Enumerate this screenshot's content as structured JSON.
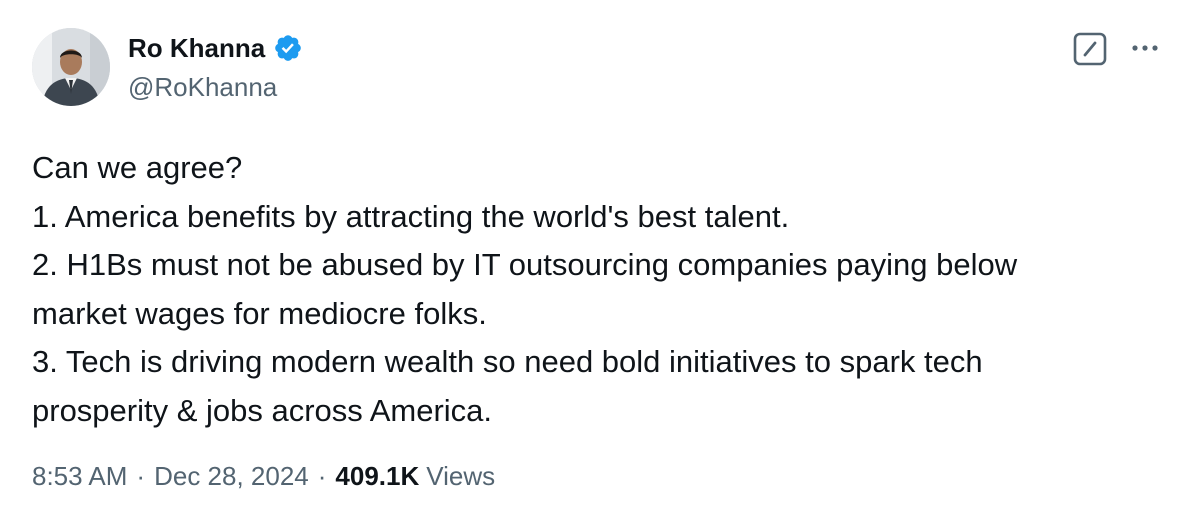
{
  "author": {
    "display_name": "Ro Khanna",
    "handle": "@RoKhanna",
    "verified": true,
    "verified_color": "#1d9bf0"
  },
  "icons": {
    "verified": "verified-badge-icon",
    "grok": "grok-icon",
    "more": "more-dots-icon"
  },
  "tweet": {
    "lines": [
      "Can we agree?",
      "1. America benefits by attracting the world's best talent.",
      "2. H1Bs must not be abused by IT outsourcing companies paying below",
      "market wages for mediocre folks.",
      "3. Tech is driving modern wealth so need bold initiatives to spark tech",
      "prosperity & jobs across America."
    ]
  },
  "meta": {
    "time": "8:53 AM",
    "separator": "·",
    "date": "Dec 28, 2024",
    "views_count": "409.1K",
    "views_label": "Views"
  },
  "colors": {
    "text": "#0f1419",
    "secondary": "#536471",
    "accent": "#1d9bf0"
  }
}
